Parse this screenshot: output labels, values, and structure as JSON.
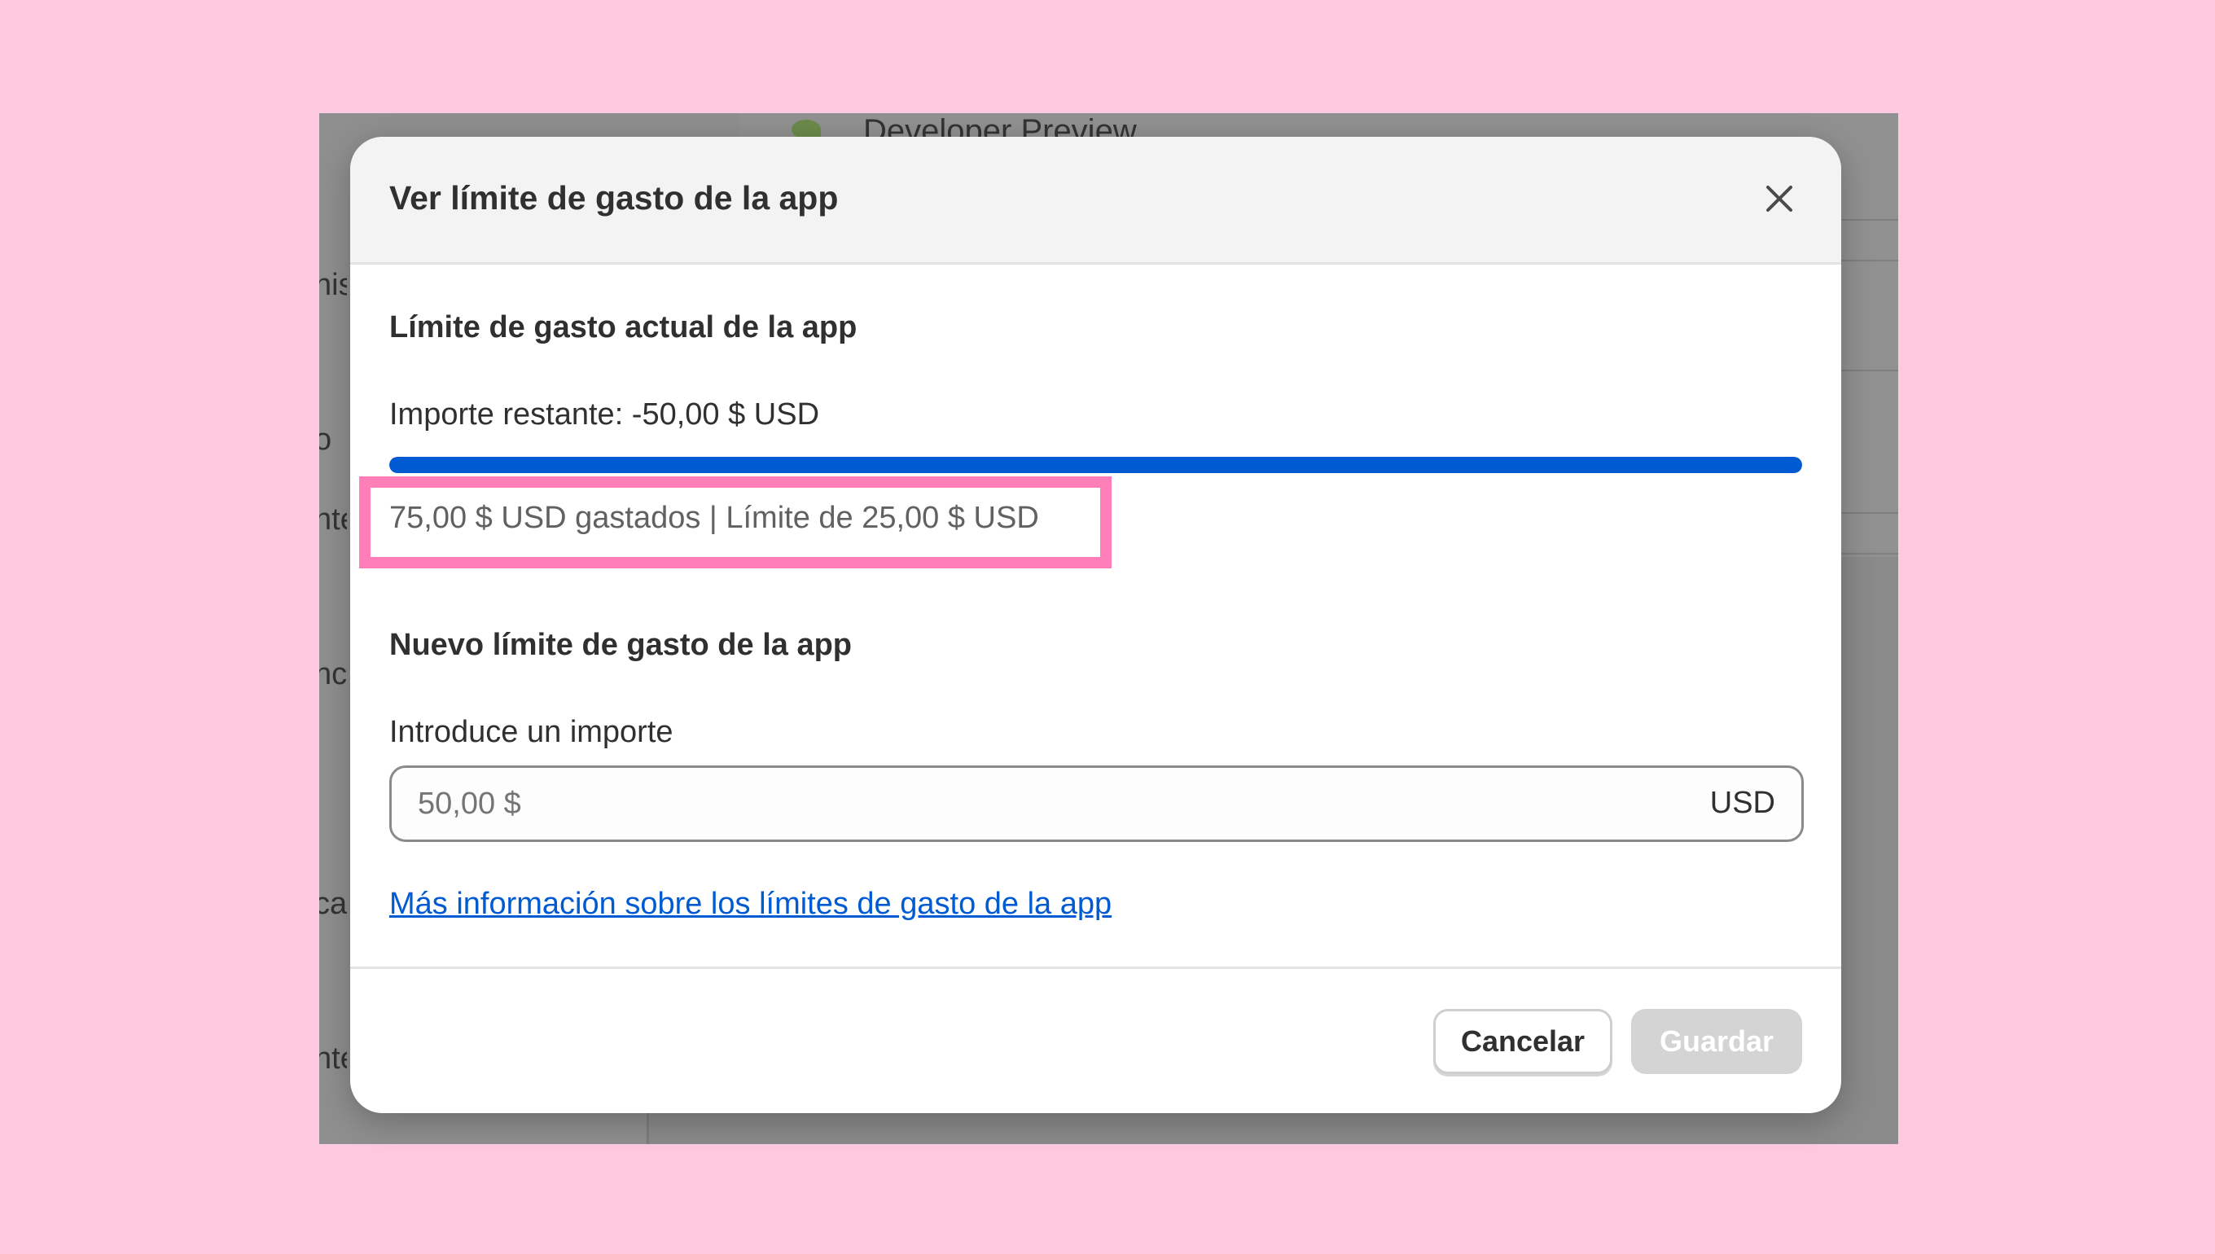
{
  "background": {
    "top_text": "Developer Preview",
    "sidebar_fragments": [
      "nis",
      "o",
      "nte",
      "nc",
      "ca",
      "nte"
    ]
  },
  "modal": {
    "title": "Ver límite de gasto de la app",
    "close_label": "Cerrar",
    "current_section": {
      "heading": "Límite de gasto actual de la app",
      "remaining_text": "Importe restante: -50,00 $ USD",
      "progress_percent": 100,
      "spent_text": "75,00 $ USD gastados | Límite de 25,00 $ USD"
    },
    "new_section": {
      "heading": "Nuevo límite de gasto de la app",
      "input_label": "Introduce un importe",
      "input_placeholder": "50,00 $",
      "input_suffix": "USD",
      "link_text": "Más información sobre los límites de gasto de la app"
    },
    "footer": {
      "cancel_label": "Cancelar",
      "save_label": "Guardar"
    }
  },
  "colors": {
    "page_background": "#ffc9df",
    "accent_blue": "#005bd3",
    "highlight_pink": "#ff7eb8",
    "disabled_button": "#d4d4d4"
  }
}
